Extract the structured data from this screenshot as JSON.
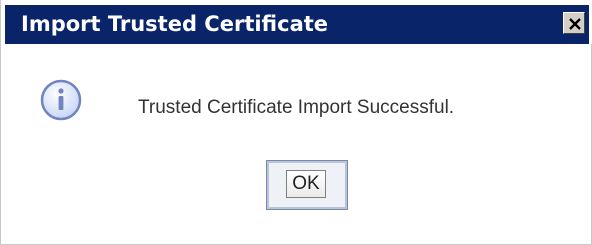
{
  "window": {
    "title": "Import Trusted Certificate",
    "close_icon": "close-icon"
  },
  "content": {
    "icon": "info-icon",
    "message": "Trusted Certificate Import Successful."
  },
  "buttons": {
    "ok_label": "OK"
  },
  "colors": {
    "titlebar": "#0a246a",
    "title_text": "#ffffff",
    "icon_fill": "#dde6fa",
    "icon_stroke": "#6f84c0"
  }
}
